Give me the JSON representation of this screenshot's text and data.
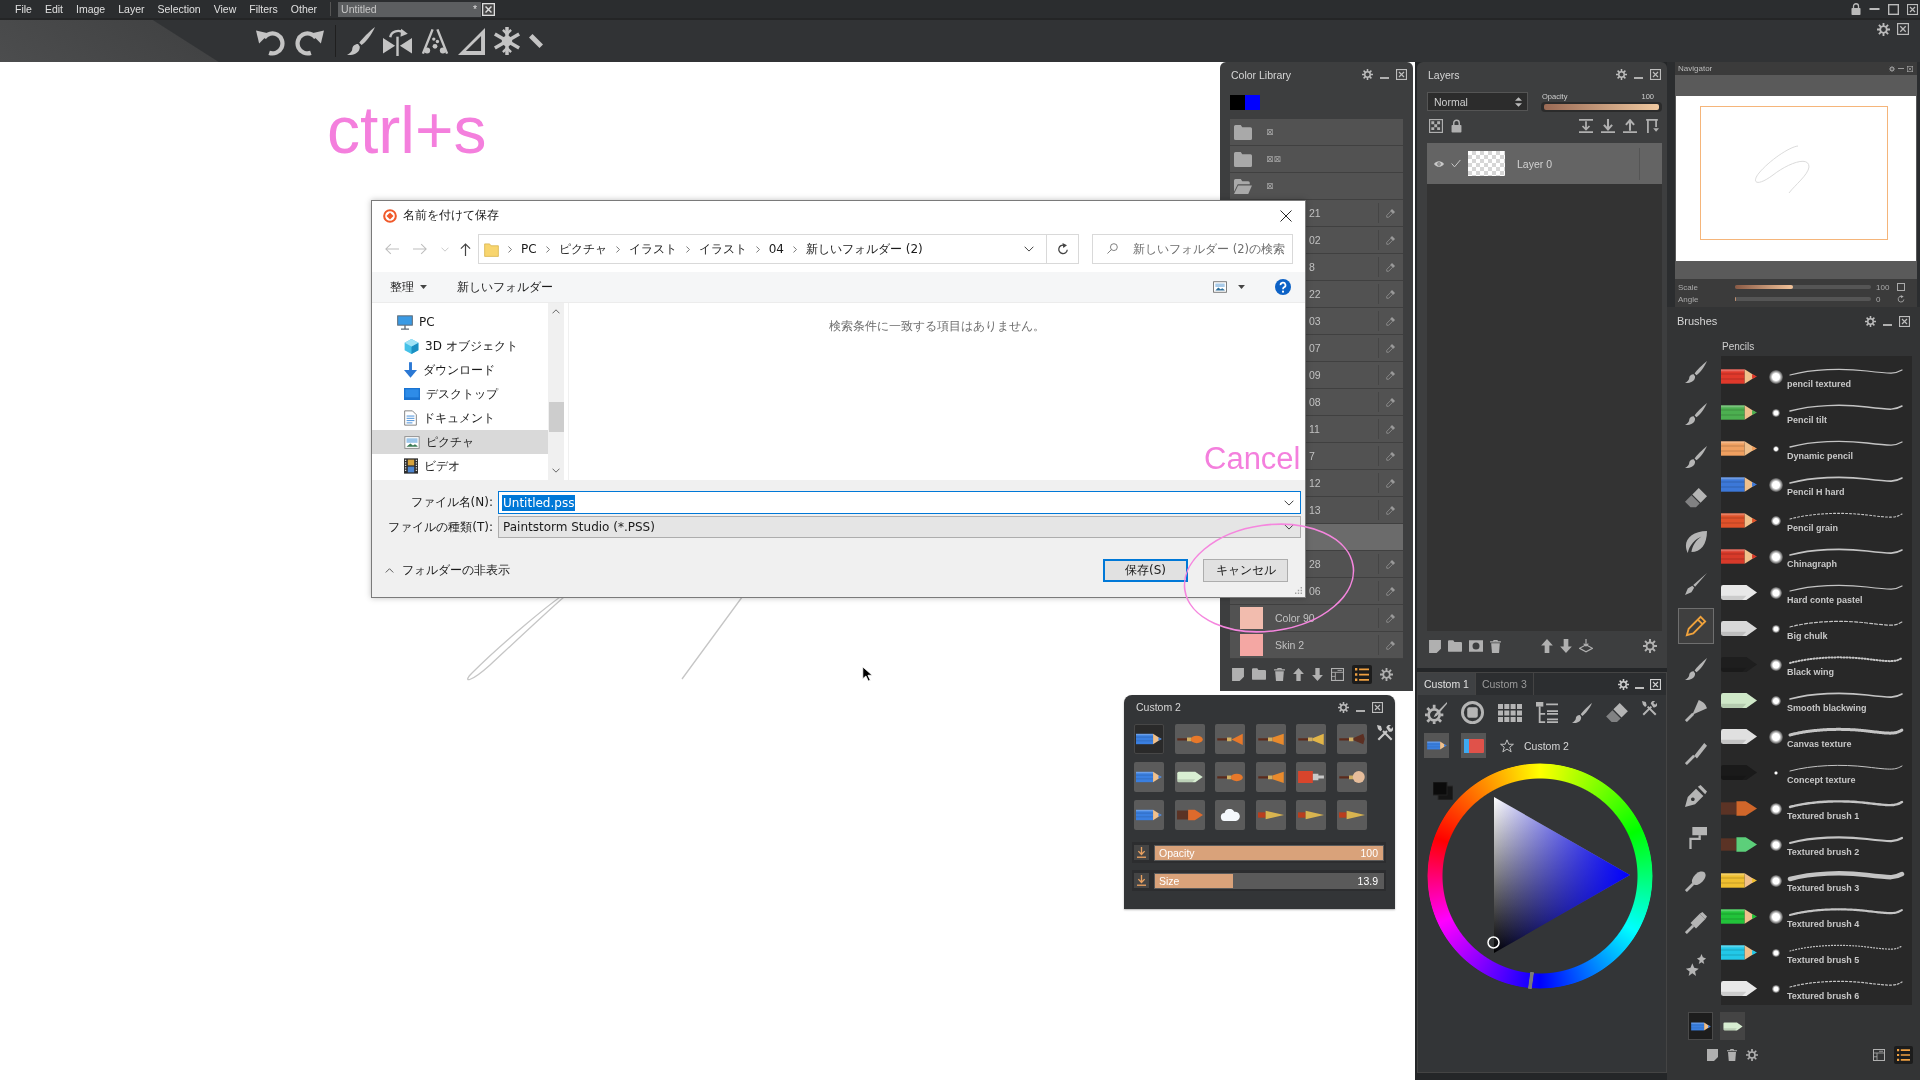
{
  "menu": [
    "File",
    "Edit",
    "Image",
    "Layer",
    "Selection",
    "View",
    "Filters",
    "Other"
  ],
  "document_tab": {
    "title": "Untitled",
    "mark": "*"
  },
  "annotations": [
    "ctrl+s",
    "Cancel"
  ],
  "save_dialog": {
    "title": "名前を付けて保存",
    "path": [
      "PC",
      "ピクチャ",
      "イラスト",
      "イラスト",
      "04",
      "新しいフォルダー (2)"
    ],
    "search": {
      "placeholder": "新しいフォルダー (2)の検索"
    },
    "commands": {
      "organize": "整理",
      "new_folder": "新しいフォルダー"
    },
    "nav_tree": [
      {
        "label": "PC",
        "kind": "pc",
        "selected": false,
        "children": [
          {
            "label": "3D オブジェクト",
            "kind": "objects",
            "selected": false
          },
          {
            "label": "ダウンロード",
            "kind": "downloads",
            "selected": false
          },
          {
            "label": "デスクトップ",
            "kind": "desktop",
            "selected": false
          },
          {
            "label": "ドキュメント",
            "kind": "documents",
            "selected": false
          },
          {
            "label": "ピクチャ",
            "kind": "pictures",
            "selected": true
          },
          {
            "label": "ビデオ",
            "kind": "videos",
            "selected": false
          }
        ]
      }
    ],
    "empty_message": "検索条件に一致する項目はありません。",
    "fields": [
      {
        "label": "ファイル名(N):",
        "value": "Untitled.pss",
        "kind": "input",
        "text_selected": true
      },
      {
        "label": "ファイルの種類(T):",
        "value": "Paintstorm Studio (*.PSS)",
        "kind": "select",
        "text_selected": false
      }
    ],
    "hide_folders": "フォルダーの非表示",
    "buttons": [
      {
        "label": "保存(S)",
        "default": true
      },
      {
        "label": "キャンセル",
        "default": false
      }
    ]
  },
  "color_library": {
    "title": "Color Library",
    "current": [
      {
        "color": "#000000"
      },
      {
        "color": "#0000ff"
      }
    ],
    "folders": [
      {
        "label": "⊠",
        "expanded": false
      },
      {
        "label": "⊠⊠",
        "expanded": false
      },
      {
        "label": "⊠",
        "expanded": true
      }
    ],
    "colors": [
      {
        "label": "21",
        "selected": false
      },
      {
        "label": "02",
        "selected": false
      },
      {
        "label": "8",
        "selected": false
      },
      {
        "label": "22",
        "selected": false
      },
      {
        "label": "03",
        "selected": false
      },
      {
        "label": "07",
        "selected": false
      },
      {
        "label": "09",
        "selected": false
      },
      {
        "label": "08",
        "selected": false
      },
      {
        "label": "11",
        "selected": false
      },
      {
        "label": "7",
        "selected": false
      },
      {
        "label": "12",
        "selected": false
      },
      {
        "label": "13",
        "selected": false
      },
      {
        "selected": true
      },
      {
        "label": "28",
        "selected": false
      },
      {
        "label": "06",
        "selected": false
      },
      {
        "label": "Color 90",
        "color": "#f2bcae",
        "selected": false
      },
      {
        "label": "Skin 2",
        "color": "#f4a7a3",
        "selected": false
      }
    ],
    "list_view": true
  },
  "layers": {
    "title": "Layers",
    "blend_mode": "Normal",
    "opacity": {
      "label": "Opacity",
      "reading": "100",
      "level": 1
    },
    "items": [
      {
        "name": "Layer 0",
        "visible": true,
        "checked": true,
        "selected": true
      }
    ]
  },
  "custom_2": {
    "title": "Custom 2",
    "presets": [
      {
        "kind": "pencil",
        "selected": true
      },
      {
        "kind": "brush",
        "selected": false
      },
      {
        "kind": "fan",
        "selected": false
      },
      {
        "kind": "flat",
        "selected": false
      },
      {
        "kind": "broom",
        "selected": false
      },
      {
        "kind": "dark",
        "selected": false
      },
      {
        "kind": "pencil",
        "selected": false
      },
      {
        "kind": "chalk",
        "selected": false
      },
      {
        "kind": "brush",
        "selected": false
      },
      {
        "kind": "flat",
        "selected": false
      },
      {
        "kind": "tube",
        "selected": false
      },
      {
        "kind": "mop",
        "selected": false
      },
      {
        "kind": "pencil",
        "selected": false
      },
      {
        "kind": "marker",
        "selected": false
      },
      {
        "kind": "cloud",
        "selected": false
      },
      {
        "kind": "nib",
        "selected": false
      },
      {
        "kind": "nib",
        "selected": false
      },
      {
        "kind": "nib",
        "selected": false
      }
    ],
    "sliders": [
      {
        "label": "Opacity",
        "reading": "100",
        "level": 1
      },
      {
        "label": "Size",
        "reading": "13.9",
        "level": 0.34
      }
    ]
  },
  "custom_1": {
    "tabs": [
      {
        "label": "Custom 1",
        "selected": true
      },
      {
        "label": "Custom 3",
        "selected": false
      }
    ],
    "preset": "Custom 2"
  },
  "navigator": {
    "title": "Navigator",
    "sliders": [
      {
        "label": "Scale",
        "reading": "100",
        "level": 0.43
      },
      {
        "label": "Angle",
        "reading": "0",
        "level": 0.01
      }
    ]
  },
  "brushes": {
    "title": "Brushes",
    "categories": [
      {
        "kind": "brush",
        "selected": false
      },
      {
        "kind": "brush",
        "selected": false
      },
      {
        "kind": "brush",
        "selected": false
      },
      {
        "kind": "eraser",
        "selected": false
      },
      {
        "kind": "leaf",
        "selected": false
      },
      {
        "kind": "pen",
        "selected": false
      },
      {
        "kind": "pencil",
        "selected": true
      },
      {
        "kind": "brush",
        "selected": false
      },
      {
        "kind": "fan",
        "selected": false
      },
      {
        "kind": "knife",
        "selected": false
      },
      {
        "kind": "nib",
        "selected": false
      },
      {
        "kind": "roller",
        "selected": false
      },
      {
        "kind": "round",
        "selected": false
      },
      {
        "kind": "flat",
        "selected": false
      },
      {
        "kind": "stars",
        "selected": false
      }
    ],
    "group": "Pencils",
    "items": [
      {
        "name": "pencil textured",
        "kind": "pencil",
        "color": "#e0392b"
      },
      {
        "name": "Pencil tilt",
        "kind": "pencil",
        "color": "#4caf50"
      },
      {
        "name": "Dynamic pencil",
        "kind": "pencil",
        "color": "#f0a060"
      },
      {
        "name": "Pencil H hard",
        "kind": "pencil",
        "color": "#3c78d8"
      },
      {
        "name": "Pencil grain",
        "kind": "pencil",
        "color": "#e0522a"
      },
      {
        "name": "Chinagraph",
        "kind": "pencil",
        "color": "#d83a2a"
      },
      {
        "name": "Hard conte pastel",
        "kind": "chalk",
        "color": "#e8e8e8"
      },
      {
        "name": "Big chulk",
        "kind": "chalk",
        "color": "#d8d8d8"
      },
      {
        "name": "Black wing",
        "kind": "chalk",
        "color": "#1e1e1e"
      },
      {
        "name": "Smooth blackwing",
        "kind": "chalk",
        "color": "#cfe8c8"
      },
      {
        "name": "Canvas texture",
        "kind": "chalk",
        "color": "#e0e0e0"
      },
      {
        "name": "Concept texture",
        "kind": "chalk",
        "color": "#1a1a1a"
      },
      {
        "name": "Textured brush 1",
        "kind": "marker",
        "color": "#d0662a"
      },
      {
        "name": "Textured brush 2",
        "kind": "marker",
        "color": "#5ccf7a"
      },
      {
        "name": "Textured brush 3",
        "kind": "pencil",
        "color": "#f0c030"
      },
      {
        "name": "Textured brush 4",
        "kind": "pencil",
        "color": "#22c33a"
      },
      {
        "name": "Textured brush 5",
        "kind": "pencil",
        "color": "#22c8e8"
      },
      {
        "name": "Textured brush 6",
        "kind": "chalk",
        "color": "#e8e8e8"
      }
    ],
    "recent": [
      {
        "kind": "pencil",
        "selected": true
      },
      {
        "kind": "chalk",
        "selected": false
      }
    ],
    "list_view": true
  }
}
